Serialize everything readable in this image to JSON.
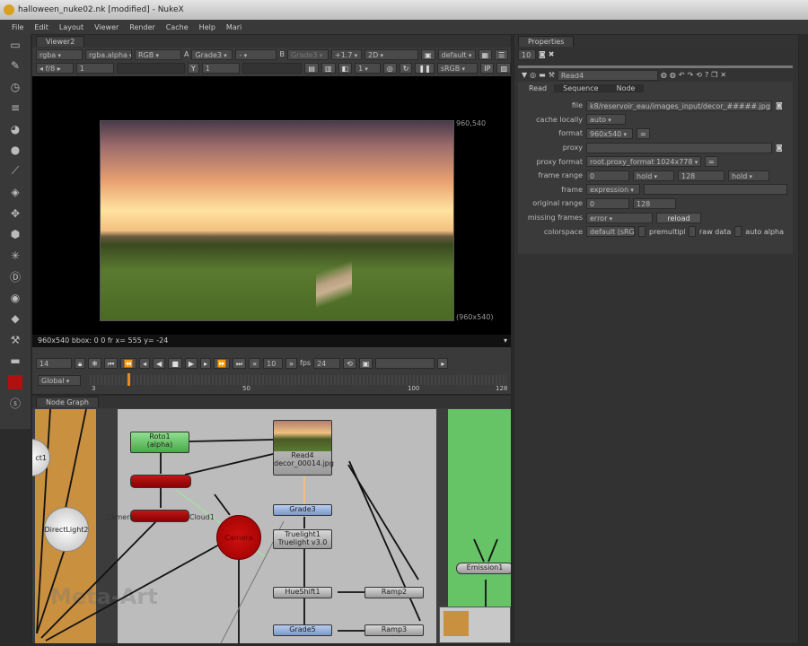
{
  "window": {
    "title": "halloween_nuke02.nk [modified] - NukeX"
  },
  "menu": [
    "File",
    "Edit",
    "Layout",
    "Viewer",
    "Render",
    "Cache",
    "Help",
    "Mari"
  ],
  "left_tools": [
    "viewer-icon",
    "paint-icon",
    "clock-icon",
    "channel-icon",
    "color-icon",
    "filter-icon",
    "keyer-icon",
    "merge-icon",
    "transform-icon",
    "3d-icon",
    "particles-icon",
    "deep-icon",
    "views-icon",
    "metadata-icon",
    "other-icon",
    "furnace-icon",
    "ocula-icon",
    "help-icon"
  ],
  "viewer": {
    "tab": "Viewer2",
    "row1": {
      "channels": "rgba",
      "alpha": "rgba.alpha",
      "display": "RGB",
      "a_label": "A",
      "a_input": "Grade3",
      "a_op": "-",
      "b_label": "B",
      "b_input": "Grade3",
      "zoom": "+1.7",
      "mode": "2D",
      "lut": "default"
    },
    "row2": {
      "fstop": "f/8",
      "gain": "1",
      "y_label": "Y",
      "gamma": "1",
      "proxy": "1",
      "colorspace": "sRGB",
      "ip": "IP"
    },
    "format_top": "960,540",
    "format_bottom": "(960x540)",
    "info": "960x540 bbox: 0 0 fr  x= 555 y= -24"
  },
  "timeline": {
    "frame": "14",
    "step": "10",
    "fps_label": "fps",
    "fps": "24",
    "scope": "Global",
    "ticks": [
      "3",
      "50",
      "100",
      "128"
    ],
    "current_fraction": 0.09
  },
  "nodegraph": {
    "tab": "Node Graph",
    "nodes": {
      "roto": "Roto1",
      "roto_sub": "(alpha)",
      "read": "Read4",
      "read_sub": "decor_00014.jpg",
      "grade3": "Grade3",
      "truelight": "Truelight1",
      "truelight_sub": "Truelight v3.0",
      "hueshift": "HueShift1",
      "ramp2": "Ramp2",
      "grade5": "Grade5",
      "ramp3": "Ramp3",
      "emission": "Emission1",
      "directlight": "DirectLight2",
      "light1": "ct1",
      "camera": "Camera",
      "pointcloud": "Cloud1"
    },
    "watermark": "Meta-Art"
  },
  "properties": {
    "tab": "Properties",
    "max_panels": "10",
    "node_name": "Read4",
    "tabs": [
      "Read",
      "Sequence",
      "Node"
    ],
    "file": "k8/reservoir_eau/images_input/decor_#####.jpg",
    "cache_locally": "auto",
    "format": "960x540",
    "proxy": "",
    "proxy_format": "root.proxy_format 1024x778",
    "frame_range_start": "0",
    "frame_range_before": "hold",
    "frame_range_end": "128",
    "frame_range_after": "hold",
    "frame_mode": "expression",
    "frame_value": "",
    "original_range_start": "0",
    "original_range_end": "128",
    "missing_frames": "error",
    "reload": "reload",
    "colorspace": "default (sRGB)",
    "premultiplied": "premultiplied",
    "raw_data": "raw data",
    "auto_alpha": "auto alpha",
    "labels": {
      "file": "file",
      "cache_locally": "cache locally",
      "format": "format",
      "proxy": "proxy",
      "proxy_format": "proxy format",
      "frame_range": "frame range",
      "frame": "frame",
      "original_range": "original range",
      "missing_frames": "missing frames",
      "colorspace": "colorspace"
    }
  }
}
